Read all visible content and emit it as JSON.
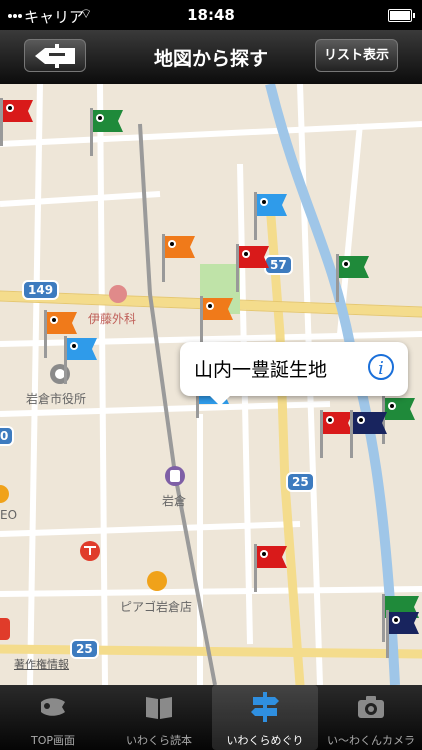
{
  "status": {
    "carrier": "キャリア",
    "time": "18:48"
  },
  "nav": {
    "title": "地図から探す",
    "list_button": "リスト表示"
  },
  "map": {
    "labels": {
      "ito": "伊藤外科",
      "city_office": "岩倉市役所",
      "station": "岩倉",
      "piago": "ピアゴ岩倉店",
      "edge_eo": "EO"
    },
    "route_numbers": {
      "r149": "149",
      "r25a": "25",
      "r25b": "25",
      "r57": "57",
      "r0": "0"
    },
    "callout": {
      "name": "山内一豊誕生地",
      "info_glyph": "i"
    },
    "legal": "著作権情報"
  },
  "tabs": [
    {
      "label": "TOP画面",
      "icon": "koinobori-icon",
      "active": false
    },
    {
      "label": "いわくら読本",
      "icon": "book-icon",
      "active": false
    },
    {
      "label": "いわくらめぐり",
      "icon": "signpost-icon",
      "active": true
    },
    {
      "label": "い〜わくんカメラ",
      "icon": "camera-icon",
      "active": false
    }
  ],
  "colors": {
    "flag_red": "#d91a1a",
    "flag_green": "#1f8a3a",
    "flag_blue": "#2f9bea",
    "flag_orange": "#f07a1a",
    "flag_navy": "#18245e",
    "active_tab": "#ffffff"
  }
}
